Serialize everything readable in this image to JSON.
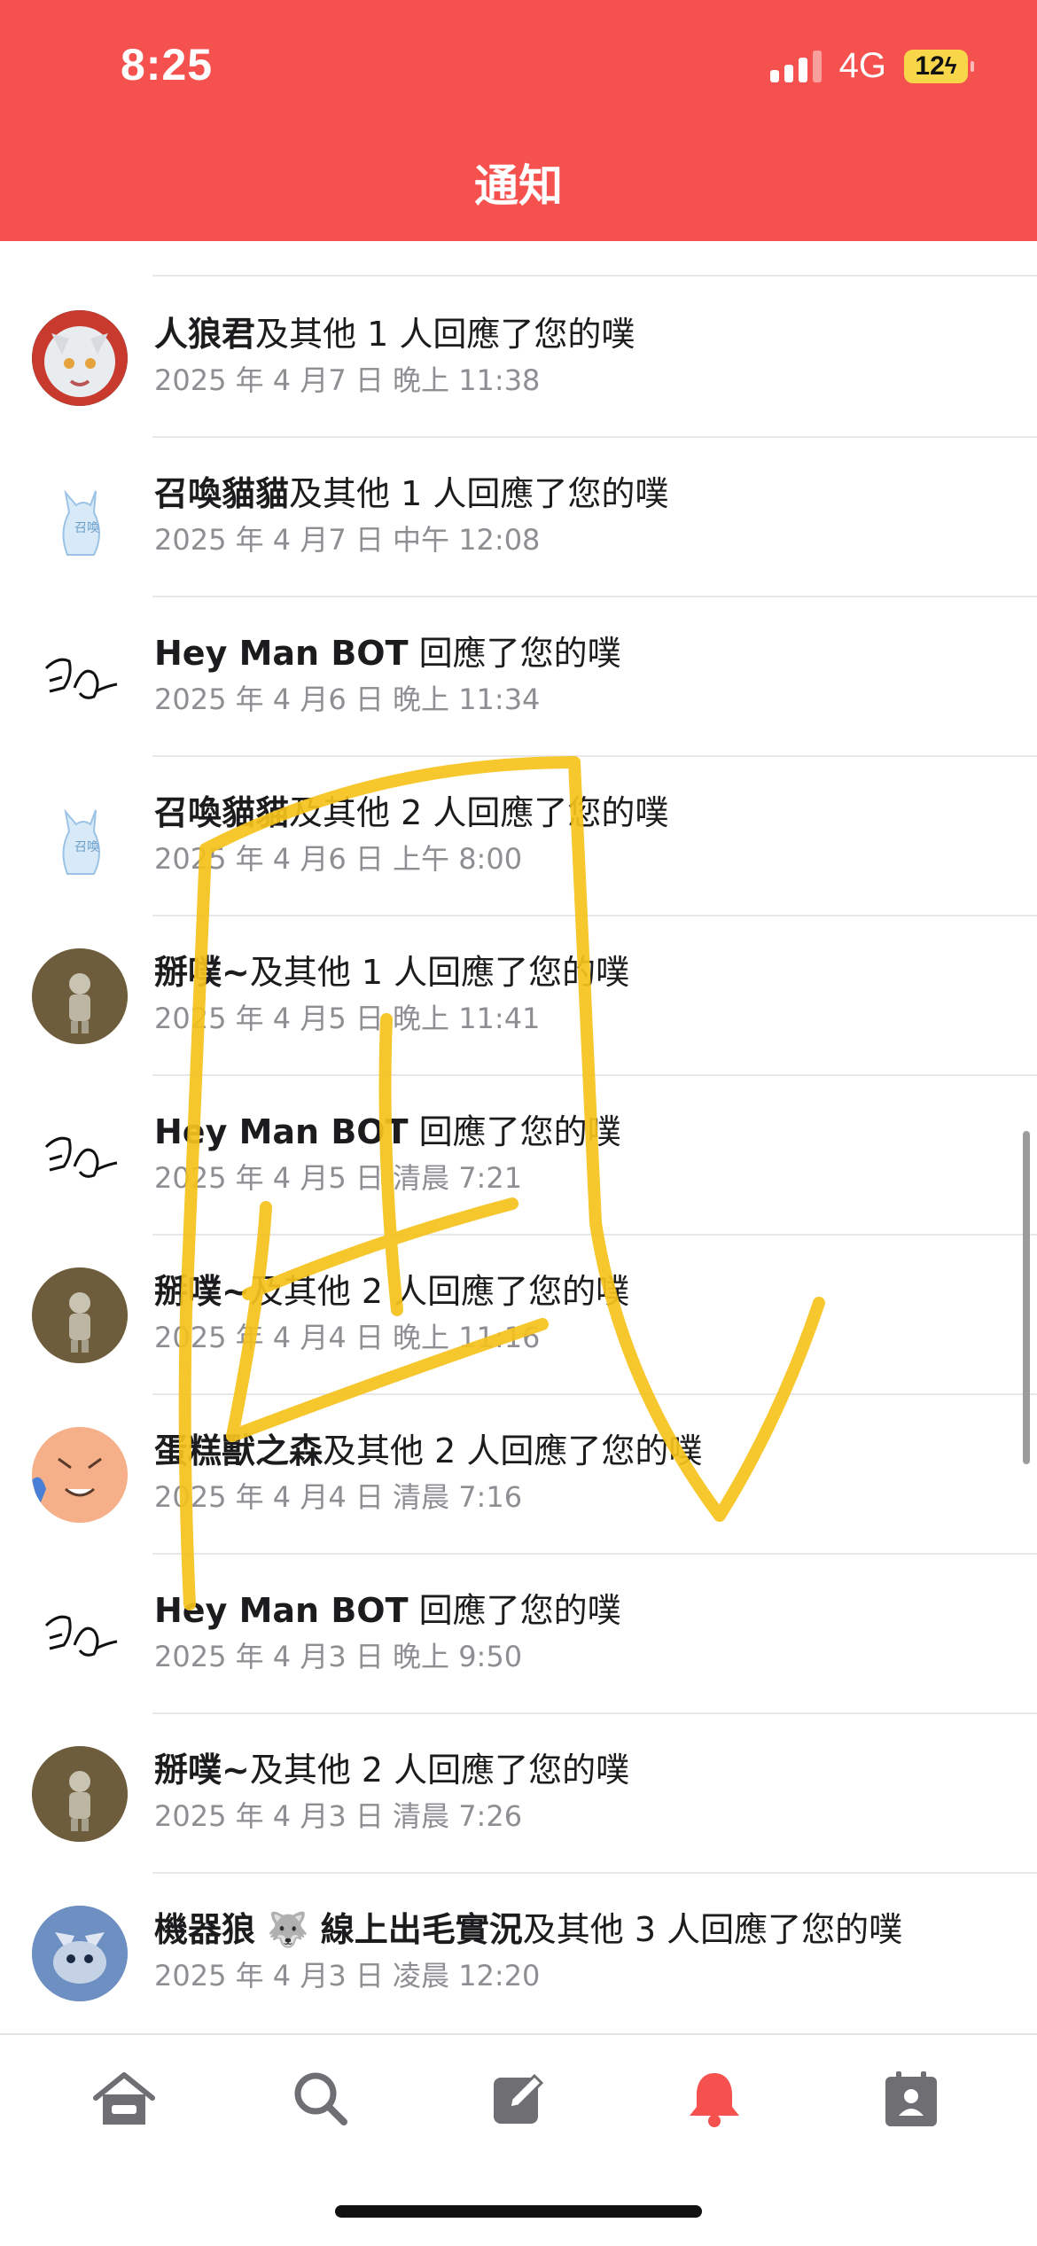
{
  "status": {
    "time": "8:25",
    "network": "4G",
    "battery": "12"
  },
  "header": {
    "title": "通知"
  },
  "notifications": [
    {
      "avatar": "wolf-avatar",
      "name": "人狼君",
      "rest": "及其他 1 人回應了您的噗",
      "time": "2025 年 4 月7 日 晚上 11:38"
    },
    {
      "avatar": "blue-cat-avatar",
      "name": "召喚貓貓",
      "rest": "及其他 1 人回應了您的噗",
      "time": "2025 年 4 月7 日 中午 12:08"
    },
    {
      "avatar": "sketch-avatar",
      "name": "Hey Man BOT",
      "rest": " 回應了您的噗",
      "time": "2025 年 4 月6 日 晚上 11:34"
    },
    {
      "avatar": "blue-cat-avatar",
      "name": "召喚貓貓",
      "rest": "及其他 2 人回應了您的噗",
      "time": "2025 年 4 月6 日 上午 8:00"
    },
    {
      "avatar": "knight-avatar",
      "name": "掰噗~",
      "rest": "及其他 1 人回應了您的噗",
      "time": "2025 年 4 月5 日 晚上 11:41"
    },
    {
      "avatar": "sketch-avatar",
      "name": "Hey Man BOT",
      "rest": " 回應了您的噗",
      "time": "2025 年 4 月5 日 清晨 7:21"
    },
    {
      "avatar": "knight-avatar",
      "name": "掰噗~",
      "rest": "及其他 2 人回應了您的噗",
      "time": "2025 年 4 月4 日 晚上 11:16"
    },
    {
      "avatar": "cake-beast-avatar",
      "name": "蛋糕獸之森",
      "rest": "及其他 2 人回應了您的噗",
      "time": "2025 年 4 月4 日 清晨 7:16"
    },
    {
      "avatar": "sketch-avatar",
      "name": "Hey Man BOT",
      "rest": " 回應了您的噗",
      "time": "2025 年 4 月3 日 晚上 9:50"
    },
    {
      "avatar": "knight-avatar",
      "name": "掰噗~",
      "rest": "及其他 2 人回應了您的噗",
      "time": "2025 年 4 月3 日 清晨 7:26"
    },
    {
      "avatar": "robot-wolf-avatar",
      "name": "機器狼 🐺 線上出毛實況",
      "rest": "及其他 3 人回應了您的噗",
      "time": "2025 年 4 月3 日 凌晨 12:20"
    }
  ],
  "tabs": [
    {
      "icon": "home-icon"
    },
    {
      "icon": "search-icon"
    },
    {
      "icon": "compose-icon"
    },
    {
      "icon": "bell-icon",
      "active": true
    },
    {
      "icon": "profile-card-icon"
    }
  ],
  "colors": {
    "accent": "#f5524f",
    "scribble": "#f6c21c"
  }
}
